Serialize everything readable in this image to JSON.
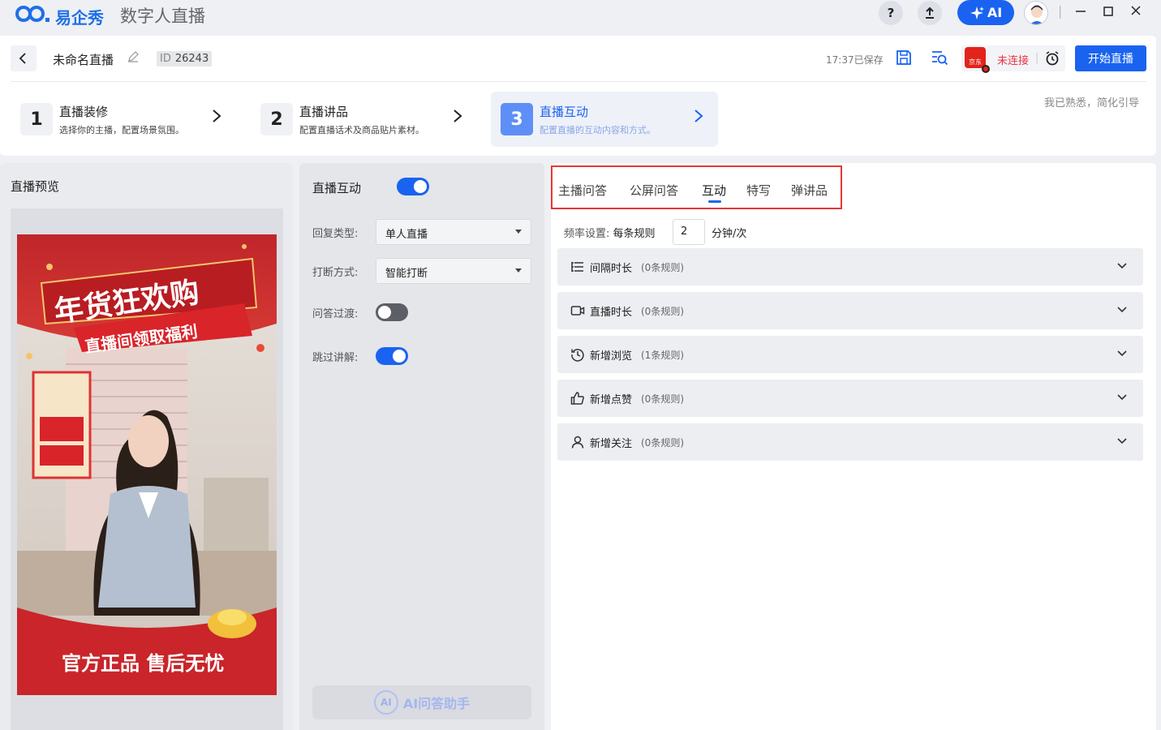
{
  "app": {
    "brand": "易企秀",
    "title": "数字人直播",
    "help_label": "?",
    "ai_label": "AI"
  },
  "header": {
    "project_name": "未命名直播",
    "id_label": "ID",
    "id_value": "26243",
    "saved_text": "17:37已保存",
    "connection_status": "未连接",
    "platform_text": "京东",
    "start_button": "开始直播"
  },
  "steps": [
    {
      "num": "1",
      "title": "直播装修",
      "desc": "选择你的主播，配置场景氛围。"
    },
    {
      "num": "2",
      "title": "直播讲品",
      "desc": "配置直播话术及商品贴片素材。"
    },
    {
      "num": "3",
      "title": "直播互动",
      "desc": "配置直播的互动内容和方式。"
    }
  ],
  "guide_link": "我已熟悉，简化引导",
  "preview": {
    "title": "直播预览",
    "poster_main": "年货狂欢购",
    "poster_sub": "直播间领取福利",
    "poster_footer": "官方正品 售后无忧"
  },
  "interaction": {
    "title": "直播互动",
    "enabled": true,
    "reply_type_label": "回复类型:",
    "reply_type_value": "单人直播",
    "interrupt_label": "打断方式:",
    "interrupt_value": "智能打断",
    "transition_label": "问答过渡:",
    "transition_enabled": false,
    "skip_label": "跳过讲解:",
    "skip_enabled": true,
    "ai_assistant_label": "AI问答助手"
  },
  "tabs": [
    "主播问答",
    "公屏问答",
    "互动",
    "特写",
    "弹讲品"
  ],
  "active_tab": "互动",
  "frequency": {
    "label": "频率设置:",
    "rule_label": "每条规则",
    "value": "2",
    "unit": "分钟/次"
  },
  "rules": [
    {
      "name": "间隔时长",
      "count": "(0条规则)",
      "icon": "list-icon"
    },
    {
      "name": "直播时长",
      "count": "(0条规则)",
      "icon": "video-icon"
    },
    {
      "name": "新增浏览",
      "count": "(1条规则)",
      "icon": "history-icon"
    },
    {
      "name": "新增点赞",
      "count": "(0条规则)",
      "icon": "thumbs-up-icon"
    },
    {
      "name": "新增关注",
      "count": "(0条规则)",
      "icon": "user-icon"
    }
  ],
  "colors": {
    "accent": "#1a63f0",
    "highlight_box": "#e53935",
    "disconnected": "#e34"
  }
}
